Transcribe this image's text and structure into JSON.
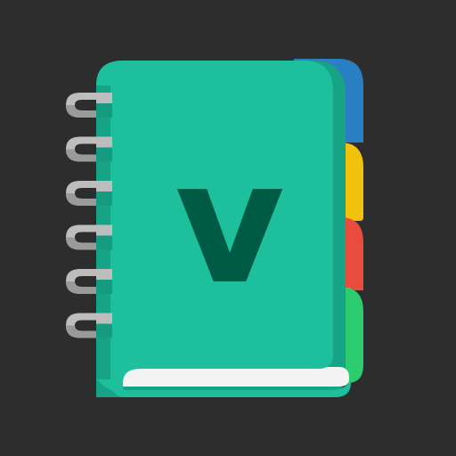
{
  "app_icon": {
    "letter": "v",
    "colors": {
      "background": "#2d2d2d",
      "cover": "#1dbf9d",
      "cover_shadow": "#17a386",
      "spine": "#179b80",
      "letter": "#005b45",
      "pages": "#f3f3f3",
      "ring_light": "#bdbdbd",
      "ring_dark": "#9a9a9a",
      "tab_blue": "#2a7fc3",
      "tab_yellow": "#f2c10e",
      "tab_red": "#e74c3c",
      "tab_green": "#2ecc71"
    },
    "tabs": [
      "blue",
      "yellow",
      "red",
      "green"
    ],
    "ring_count": 6
  }
}
